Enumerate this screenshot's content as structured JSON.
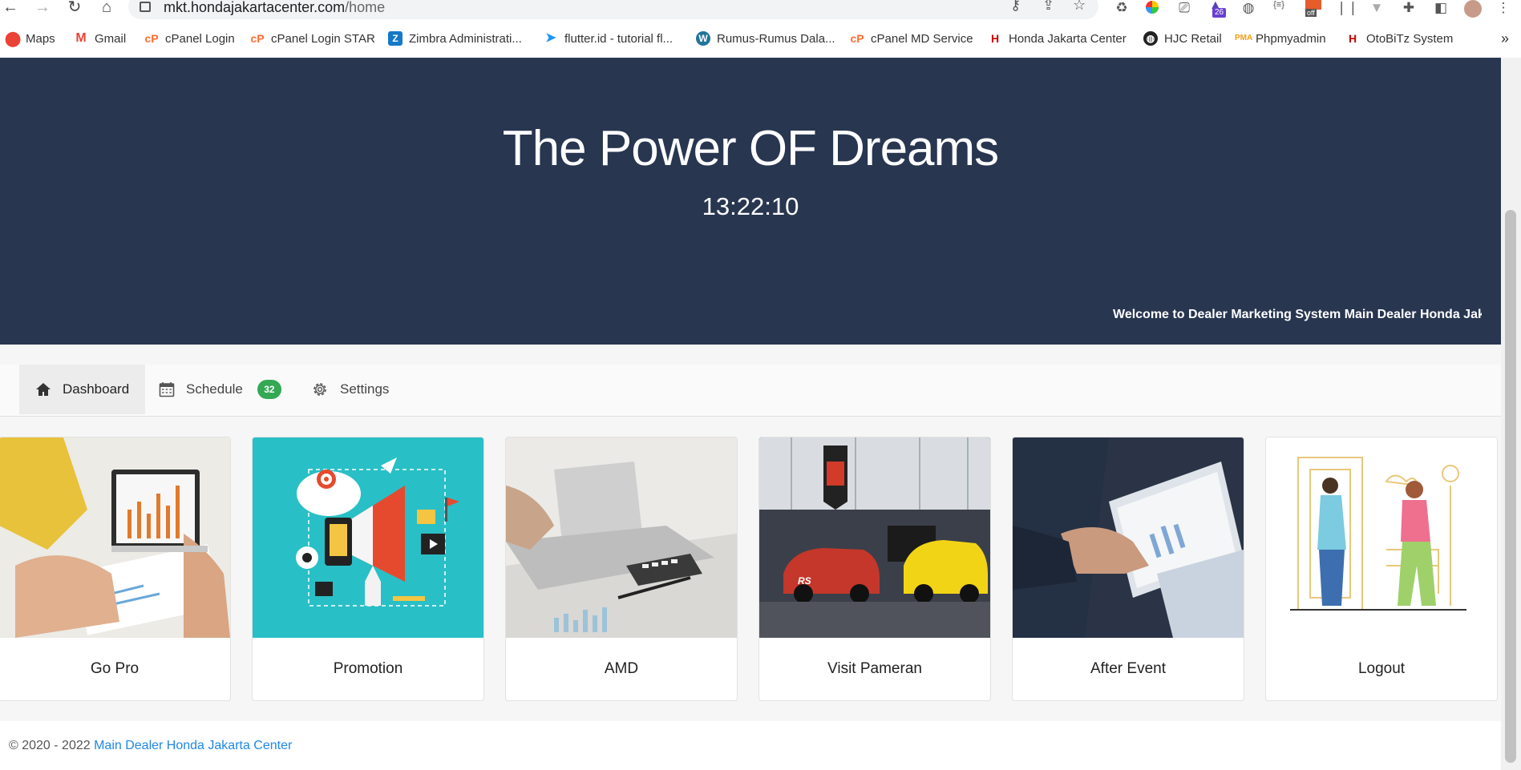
{
  "browser": {
    "url_host": "mkt.hondajakartacenter.com",
    "url_path": "/home",
    "extension_badge": "26",
    "extension_off": "off",
    "extension_brace": "{≡}",
    "bookmarks": [
      {
        "label": "Maps",
        "icon": "maps-pin-icon",
        "color": "#ea4335"
      },
      {
        "label": "Gmail",
        "icon": "gmail-icon",
        "color": "#ea4335"
      },
      {
        "label": "cPanel Login",
        "icon": "cpanel-icon",
        "color": "#ff6c2c"
      },
      {
        "label": "cPanel Login STAR",
        "icon": "cpanel-icon",
        "color": "#ff6c2c"
      },
      {
        "label": "Zimbra Administrati...",
        "icon": "zimbra-icon",
        "color": "#1479c8"
      },
      {
        "label": "flutter.id - tutorial fl...",
        "icon": "flutter-icon",
        "color": "#2196f3"
      },
      {
        "label": "Rumus-Rumus Dala...",
        "icon": "wordpress-icon",
        "color": "#21759b"
      },
      {
        "label": "cPanel MD Service",
        "icon": "cpanel-icon",
        "color": "#ff6c2c"
      },
      {
        "label": "Honda Jakarta Center",
        "icon": "honda-icon",
        "color": "#cc0000"
      },
      {
        "label": "HJC Retail",
        "icon": "globe-icon",
        "color": "#222222"
      },
      {
        "label": "Phpmyadmin",
        "icon": "phpmyadmin-icon",
        "color": "#f89c0e"
      },
      {
        "label": "OtoBiTz System",
        "icon": "honda-icon",
        "color": "#cc0000"
      }
    ],
    "more_bookmarks": "»"
  },
  "hero": {
    "title": "The Power OF Dreams",
    "clock": "13:22:10",
    "marquee": "Welcome to Dealer Marketing System Main Dealer Honda Jakarta Center",
    "background": "#283650"
  },
  "tabs": [
    {
      "label": "Dashboard",
      "icon": "home-icon"
    },
    {
      "label": "Schedule",
      "icon": "calendar-icon",
      "badge": "32"
    },
    {
      "label": "Settings",
      "icon": "gear-icon"
    }
  ],
  "cards": [
    {
      "label": "Go Pro"
    },
    {
      "label": "Promotion"
    },
    {
      "label": "AMD"
    },
    {
      "label": "Visit Pameran"
    },
    {
      "label": "After Event"
    },
    {
      "label": "Logout"
    }
  ],
  "footer": {
    "prefix": "© 2020 - 2022 ",
    "link": "Main Dealer Honda Jakarta Center",
    "link_color": "#1e88e5"
  }
}
